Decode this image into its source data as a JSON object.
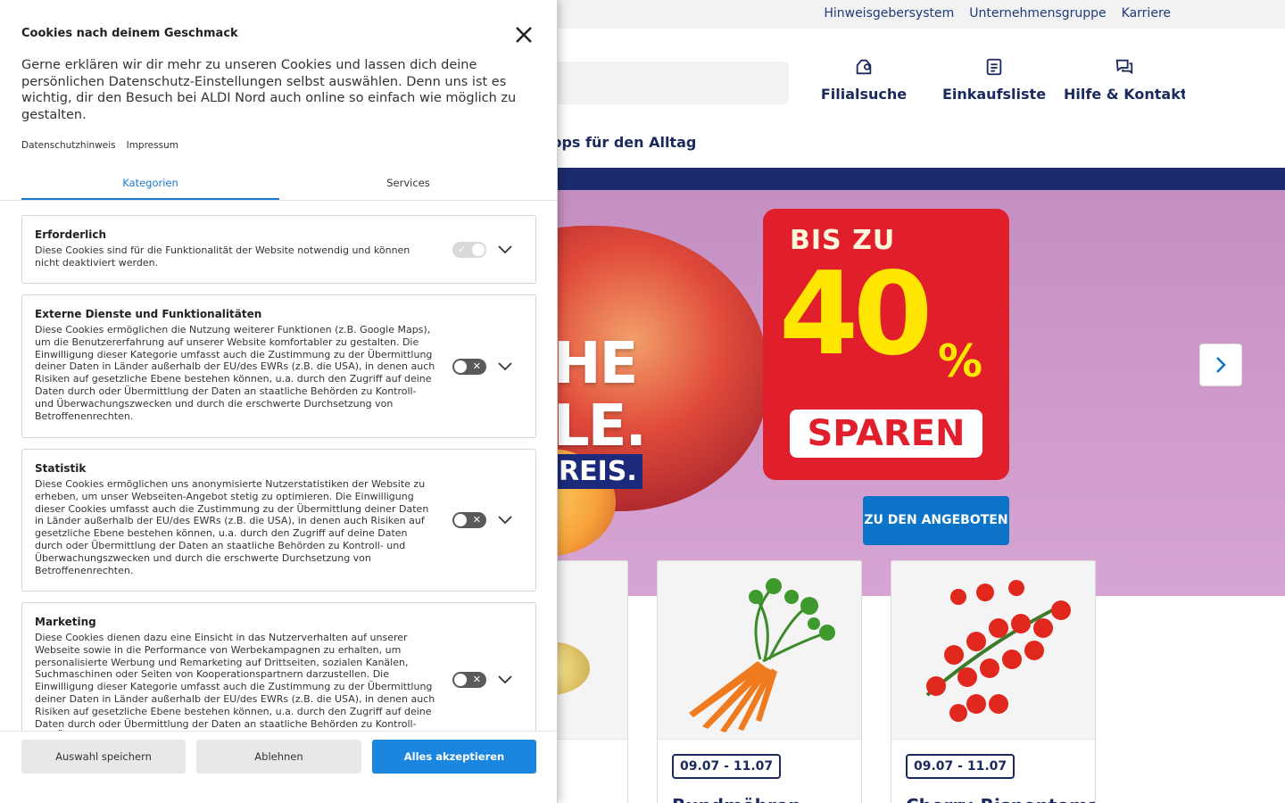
{
  "topbar": {
    "links": [
      "Hinweisgebersystem",
      "Unternehmensgruppe",
      "Karriere"
    ]
  },
  "nav": {
    "filialsuche": "Filialsuche",
    "einkaufsliste": "Einkaufsliste",
    "hilfe": "Hilfe & Kontakt",
    "subnav_partial": "pps für den Alltag"
  },
  "hero": {
    "headline_partial_1": "HE",
    "headline_partial_2": "LE.",
    "price_partial": "REIS.",
    "promo_bis": "BIS ZU",
    "promo_number": "40",
    "promo_percent": "%",
    "promo_sparen": "SPAREN",
    "cta_label": "ZU DEN ANGEBOTEN",
    "next_icon": "chevron-right-icon"
  },
  "products": [
    {
      "date": "",
      "title": ""
    },
    {
      "date": "09.07 - 11.07",
      "title": "Bundmöhren"
    },
    {
      "date": "09.07 - 11.07",
      "title": "Cherry-Rispentomaten"
    }
  ],
  "cookie": {
    "title": "Cookies nach deinem Geschmack",
    "intro": "Gerne erklären wir dir mehr zu unseren Cookies und lassen dich deine persönlichen Datenschutz-Einstellungen selbst auswählen. Denn uns ist es wichtig, dir den Besuch bei ALDI Nord auch online so einfach wie möglich zu gestalten.",
    "links": {
      "privacy": "Datenschutzhinweis",
      "imprint": "Impressum"
    },
    "tabs": {
      "categories": "Kategorien",
      "services": "Services"
    },
    "categories": [
      {
        "title": "Erforderlich",
        "desc": "Diese Cookies sind für die Funktionalität der Website notwendig und können nicht deaktiviert werden.",
        "toggle": "on-disabled"
      },
      {
        "title": "Externe Dienste und Funktionalitäten",
        "desc": "Diese Cookies ermöglichen die Nutzung weiterer Funktionen (z.B. Google Maps), um die Benutzererfahrung auf unserer Website komfortabler zu gestalten. Die Einwilligung dieser Kategorie umfasst auch die Zustimmung zu der Übermittlung deiner Daten in Länder außerhalb der EU/des EWRs (z.B. die USA), in denen auch Risiken auf gesetzliche Ebene bestehen können, u.a. durch den Zugriff auf deine Daten durch oder Übermittlung der Daten an staatliche Behörden zu Kontroll- und Überwachungszwecken und durch die erschwerte Durchsetzung von Betroffenenrechten.",
        "toggle": "off"
      },
      {
        "title": "Statistik",
        "desc": "Diese Cookies ermöglichen uns anonymisierte Nutzerstatistiken der Website zu erheben, um unser Webseiten-Angebot stetig zu optimieren. Die Einwilligung dieser Cookies umfasst auch die Zustimmung zu der Übermittlung deiner Daten in Länder außerhalb der EU/des EWRs (z.B. die USA), in denen auch Risiken auf gesetzliche Ebene bestehen können, u.a. durch den Zugriff auf deine Daten durch oder Übermittlung der Daten an staatliche Behörden zu Kontroll- und Überwachungszwecken und durch die erschwerte Durchsetzung von Betroffenenrechten.",
        "toggle": "off"
      },
      {
        "title": "Marketing",
        "desc": "Diese Cookies dienen dazu eine Einsicht in das Nutzerverhalten auf unserer Webseite sowie in die Performance von Werbekampagnen zu erhalten, um personalisierte Werbung und Remarketing auf Drittseiten, sozialen Kanälen, Suchmaschinen oder Seiten von Kooperationspartnern darzustellen. Die Einwilligung dieser Kategorie umfasst auch die Zustimmung zu der Übermittlung deiner Daten in Länder außerhalb der EU/des EWRs (z.B. die USA), in denen auch Risiken auf gesetzliche Ebene bestehen können, u.a. durch den Zugriff auf deine Daten durch oder Übermittlung der Daten an staatliche Behörden zu Kontroll- und Überwachungszwecken und durch",
        "toggle": "off"
      }
    ],
    "buttons": {
      "save": "Auswahl speichern",
      "deny": "Ablehnen",
      "accept": "Alles akzeptieren"
    }
  },
  "colors": {
    "brand_blue": "#1c2a6e",
    "accent_blue": "#1b86e0",
    "promo_red": "#e11e2b",
    "promo_yellow": "#ffe600",
    "hero_pink": "#d7a5d3"
  }
}
